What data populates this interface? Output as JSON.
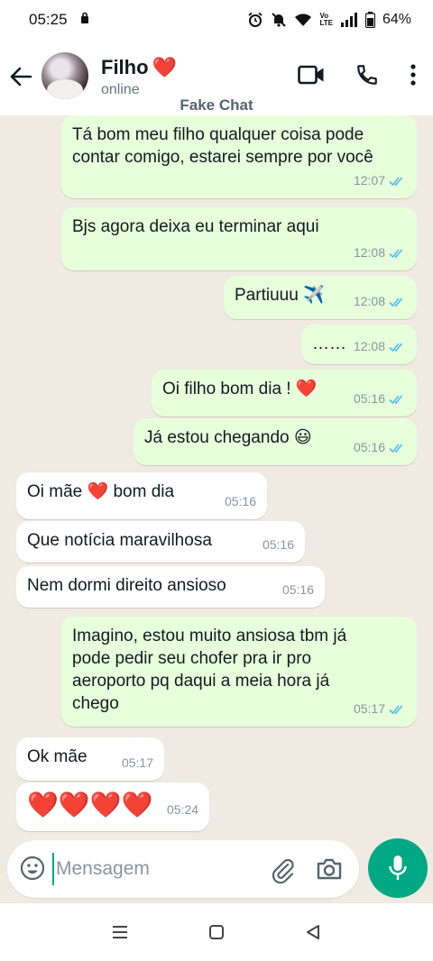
{
  "status_bar": {
    "time": "05:25",
    "battery": "64%"
  },
  "header": {
    "contact_name": "Filho",
    "name_emoji": "❤️",
    "contact_status": "online",
    "overlay_label": "Fake Chat"
  },
  "messages": [
    {
      "direction": "out",
      "text": "Tá bom meu filho qualquer coisa pode contar comigo, estarei sempre por você",
      "time": "12:07"
    },
    {
      "direction": "out",
      "text": "Bjs agora deixa eu terminar aqui",
      "time": "12:08"
    },
    {
      "direction": "out",
      "text": "Partiuuu ✈️",
      "time": "12:08"
    },
    {
      "direction": "out",
      "text": "……",
      "time": "12:08"
    },
    {
      "direction": "out",
      "text": "Oi filho bom dia ! ❤️",
      "time": "05:16"
    },
    {
      "direction": "out",
      "text": "Já estou chegando 😃",
      "time": "05:16"
    },
    {
      "direction": "in",
      "text": "Oi mãe ❤️ bom dia",
      "time": "05:16"
    },
    {
      "direction": "in",
      "text": "Que notícia maravilhosa",
      "time": "05:16"
    },
    {
      "direction": "in",
      "text": "Nem dormi direito ansioso",
      "time": "05:16"
    },
    {
      "direction": "out",
      "text": "Imagino, estou muito ansiosa tbm já pode pedir seu chofer pra ir pro aeroporto pq daqui a meia hora já chego",
      "time": "05:17"
    },
    {
      "direction": "in",
      "text": "Ok mãe",
      "time": "05:17"
    },
    {
      "direction": "in",
      "text": "❤️❤️❤️❤️",
      "time": "05:24"
    }
  ],
  "input": {
    "placeholder": "Mensagem",
    "value": ""
  },
  "colors": {
    "outgoing_bubble": "#e7ffdb",
    "incoming_bubble": "#ffffff",
    "chat_background": "#efeae2",
    "accent": "#00a884",
    "read_ticks": "#53bdeb"
  },
  "icons": [
    "back-arrow-icon",
    "video-call-icon",
    "phone-icon",
    "more-vert-icon",
    "emoji-icon",
    "attach-icon",
    "camera-icon",
    "mic-icon",
    "read-ticks-icon",
    "recents-icon",
    "home-icon",
    "back-nav-icon"
  ]
}
